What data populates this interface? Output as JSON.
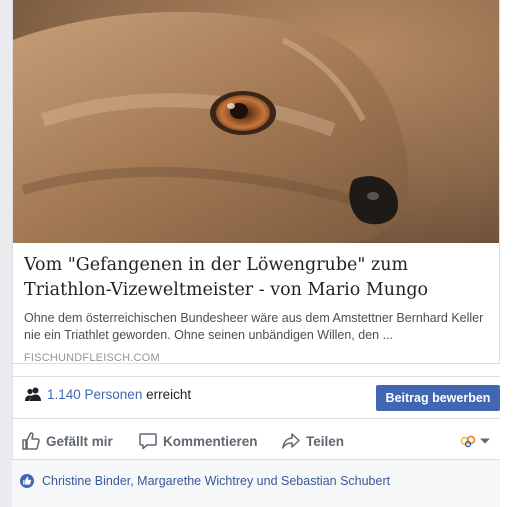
{
  "link_preview": {
    "title": "Vom \"Gefangenen in der Löwengrube\" zum Triathlon-Vizeweltmeister - von Mario Mungo",
    "description": "Ohne dem österreichischen Bundesheer wäre aus dem Amstettner Bernhard Keller nie ein Triathlet geworden. Ohne seinen unbändigen Willen, den ...",
    "domain": "FISCHUNDFLEISCH.COM",
    "image_icon": "mongoose-photo"
  },
  "reach": {
    "icon": "people-icon",
    "count": "1.140 Personen",
    "suffix": " erreicht",
    "boost_label": "Beitrag bewerben"
  },
  "actions": {
    "like_label": "Gefällt mir",
    "comment_label": "Kommentieren",
    "share_label": "Teilen"
  },
  "likes": {
    "names": "Christine Binder, Margarethe Wichtrey und Sebastian Schubert"
  },
  "colors": {
    "accent": "#4267b2",
    "link": "#385898",
    "muted": "#606770"
  }
}
